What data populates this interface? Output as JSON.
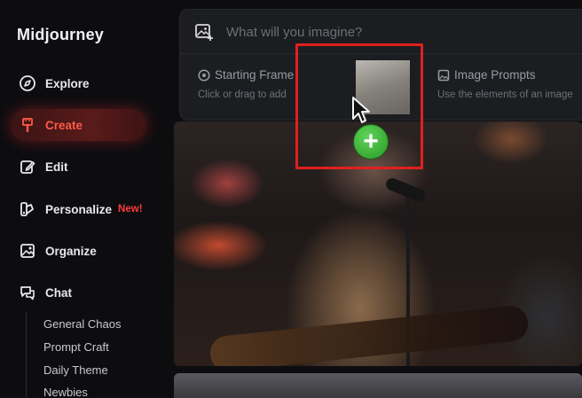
{
  "app": {
    "title": "Midjourney"
  },
  "sidebar": {
    "items": [
      {
        "label": "Explore",
        "icon": "compass-icon"
      },
      {
        "label": "Create",
        "icon": "brush-icon",
        "active": true
      },
      {
        "label": "Edit",
        "icon": "edit-icon"
      },
      {
        "label": "Personalize",
        "icon": "palette-icon",
        "badge": "New!"
      },
      {
        "label": "Organize",
        "icon": "image-icon"
      },
      {
        "label": "Chat",
        "icon": "chat-icon"
      }
    ],
    "chat_rooms": [
      "General Chaos",
      "Prompt Craft",
      "Daily Theme",
      "Newbies"
    ]
  },
  "prompt": {
    "placeholder": "What will you imagine?",
    "options": [
      {
        "title": "Starting Frame",
        "description": "Click or drag to add"
      },
      {
        "title": "Image Prompts",
        "description": "Use the elements of an image"
      }
    ]
  },
  "colors": {
    "accent": "#e0201e",
    "active_text": "#ff5a4a",
    "badge": "#ff3b3b",
    "plus_green": "#2fa52a"
  }
}
